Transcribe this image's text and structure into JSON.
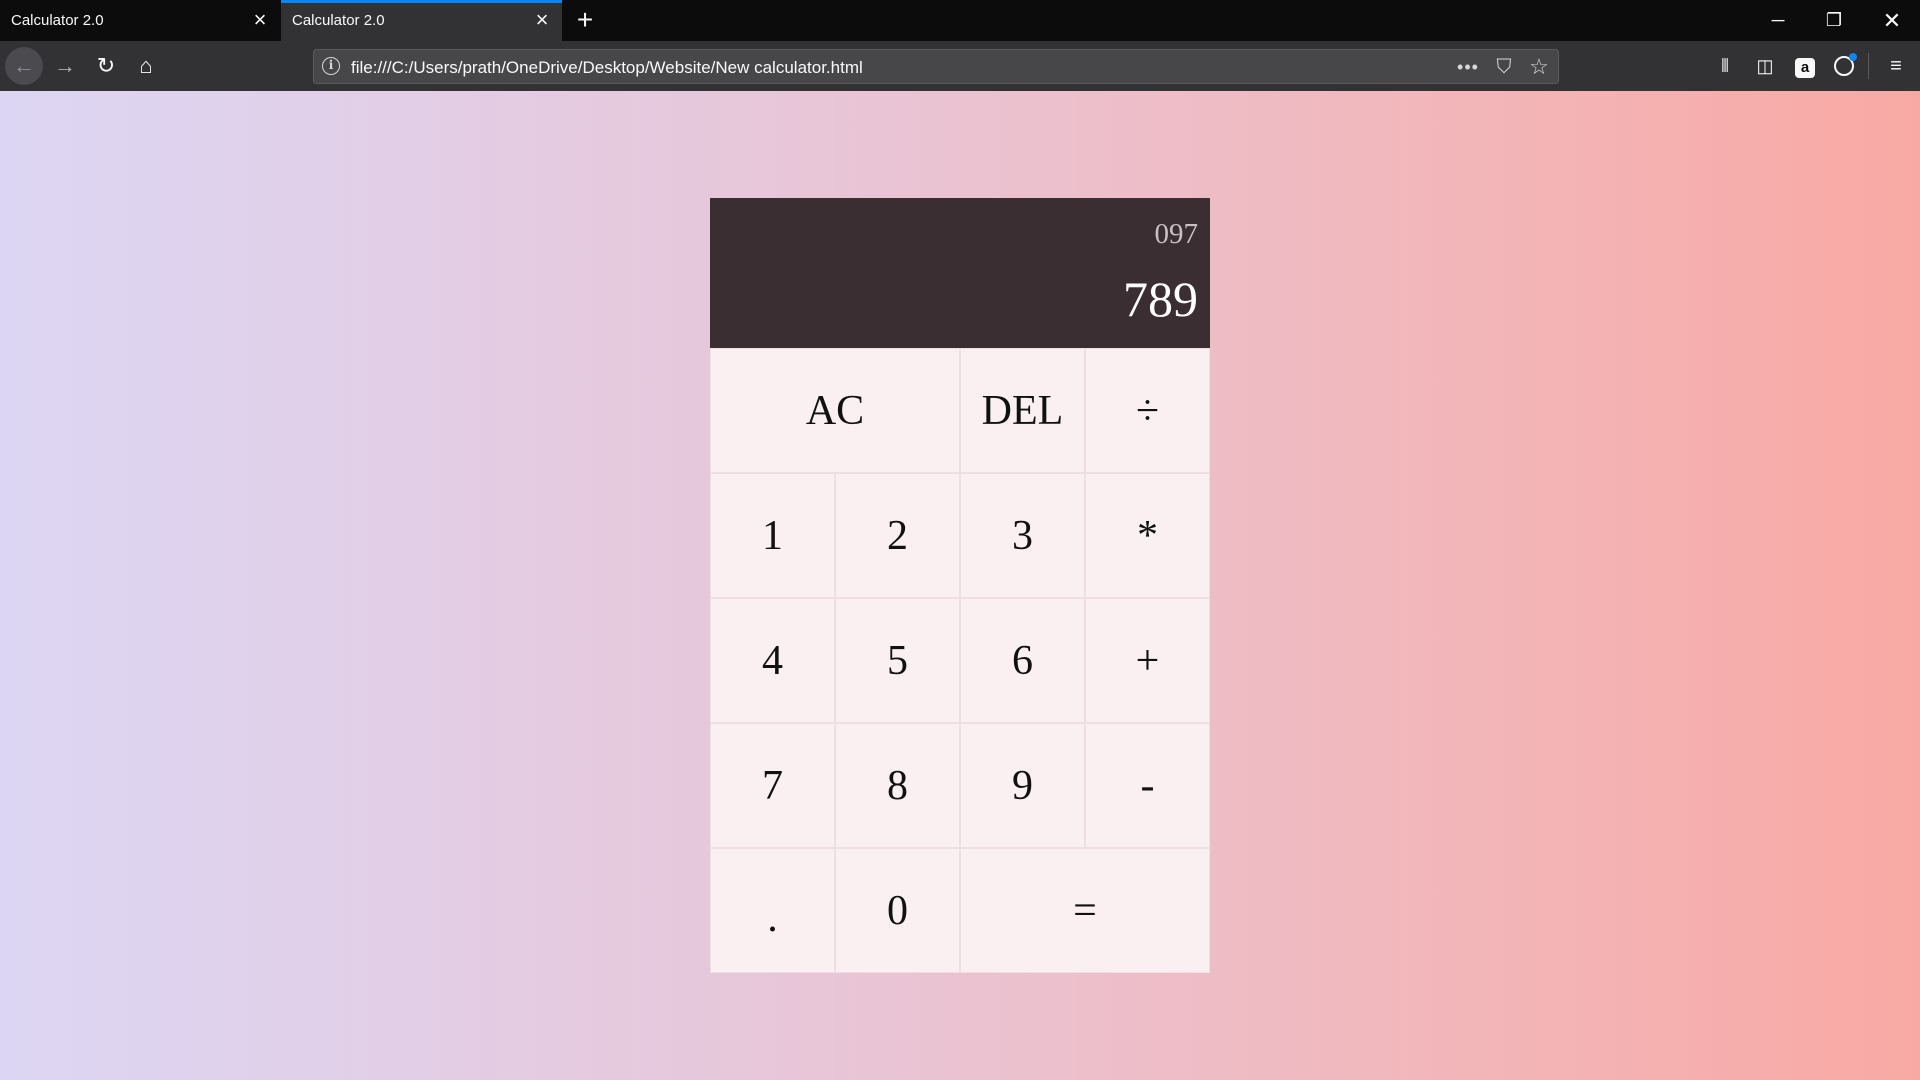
{
  "browser": {
    "tabs": [
      {
        "title": "Calculator 2.0",
        "close_icon": "×"
      },
      {
        "title": "Calculator 2.0",
        "close_icon": "×"
      }
    ],
    "new_tab_icon": "+",
    "window_controls": {
      "minimize": "─",
      "maximize": "❐",
      "close": "✕"
    },
    "nav": {
      "back": "←",
      "forward": "→",
      "reload": "↻",
      "home": "⌂"
    },
    "url": "file:///C:/Users/prath/OneDrive/Desktop/Website/New calculator.html",
    "url_info_icon": "i",
    "url_actions": {
      "more": "•••",
      "pocket": "⛉",
      "bookmark": "☆"
    },
    "toolbar": {
      "library": "⫴",
      "sidebar": "◫",
      "amazon": "a",
      "menu": "≡"
    },
    "accent_color": "#0a84ff"
  },
  "calculator": {
    "previous_operand": "097",
    "current_operand": "789",
    "keys": {
      "all_clear": "AC",
      "delete": "DEL",
      "divide": "÷",
      "one": "1",
      "two": "2",
      "three": "3",
      "multiply": "*",
      "four": "4",
      "five": "5",
      "six": "6",
      "add": "+",
      "seven": "7",
      "eight": "8",
      "nine": "9",
      "subtract": "-",
      "decimal": ".",
      "zero": "0",
      "equals": "="
    },
    "display_bg": "#3b2e33",
    "key_bg": "#faf0f2"
  }
}
